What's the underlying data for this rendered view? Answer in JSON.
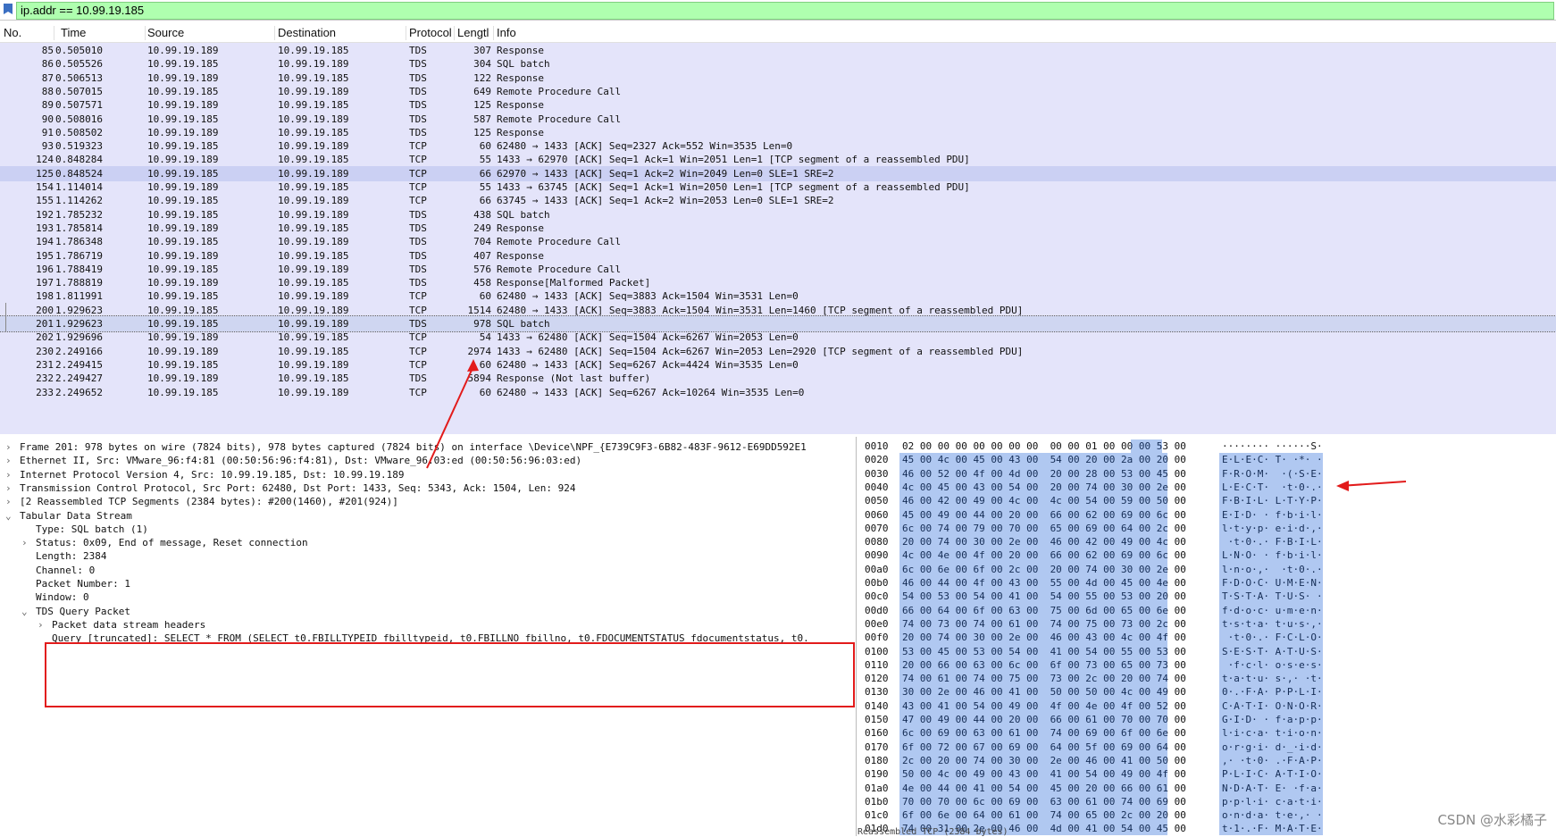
{
  "filter": {
    "text": "ip.addr == 10.99.19.185"
  },
  "columns": [
    "No.",
    "Time",
    "Source",
    "Destination",
    "Protocol",
    "Lengtl",
    "Info"
  ],
  "packets": [
    {
      "no": "85",
      "time": "0.505010",
      "src": "10.99.19.189",
      "dst": "10.99.19.185",
      "proto": "TDS",
      "len": "307",
      "info": "Response"
    },
    {
      "no": "86",
      "time": "0.505526",
      "src": "10.99.19.185",
      "dst": "10.99.19.189",
      "proto": "TDS",
      "len": "304",
      "info": "SQL batch"
    },
    {
      "no": "87",
      "time": "0.506513",
      "src": "10.99.19.189",
      "dst": "10.99.19.185",
      "proto": "TDS",
      "len": "122",
      "info": "Response"
    },
    {
      "no": "88",
      "time": "0.507015",
      "src": "10.99.19.185",
      "dst": "10.99.19.189",
      "proto": "TDS",
      "len": "649",
      "info": "Remote Procedure Call"
    },
    {
      "no": "89",
      "time": "0.507571",
      "src": "10.99.19.189",
      "dst": "10.99.19.185",
      "proto": "TDS",
      "len": "125",
      "info": "Response"
    },
    {
      "no": "90",
      "time": "0.508016",
      "src": "10.99.19.185",
      "dst": "10.99.19.189",
      "proto": "TDS",
      "len": "587",
      "info": "Remote Procedure Call"
    },
    {
      "no": "91",
      "time": "0.508502",
      "src": "10.99.19.189",
      "dst": "10.99.19.185",
      "proto": "TDS",
      "len": "125",
      "info": "Response"
    },
    {
      "no": "93",
      "time": "0.519323",
      "src": "10.99.19.185",
      "dst": "10.99.19.189",
      "proto": "TCP",
      "len": "60",
      "info": "62480 → 1433 [ACK] Seq=2327 Ack=552 Win=3535 Len=0"
    },
    {
      "no": "124",
      "time": "0.848284",
      "src": "10.99.19.189",
      "dst": "10.99.19.185",
      "proto": "TCP",
      "len": "55",
      "info": "1433 → 62970 [ACK] Seq=1 Ack=1 Win=2051 Len=1 [TCP segment of a reassembled PDU]"
    },
    {
      "no": "125",
      "time": "0.848524",
      "src": "10.99.19.185",
      "dst": "10.99.19.189",
      "proto": "TCP",
      "len": "66",
      "info": "62970 → 1433 [ACK] Seq=1 Ack=2 Win=2049 Len=0 SLE=1 SRE=2"
    },
    {
      "no": "154",
      "time": "1.114014",
      "src": "10.99.19.189",
      "dst": "10.99.19.185",
      "proto": "TCP",
      "len": "55",
      "info": "1433 → 63745 [ACK] Seq=1 Ack=1 Win=2050 Len=1 [TCP segment of a reassembled PDU]"
    },
    {
      "no": "155",
      "time": "1.114262",
      "src": "10.99.19.185",
      "dst": "10.99.19.189",
      "proto": "TCP",
      "len": "66",
      "info": "63745 → 1433 [ACK] Seq=1 Ack=2 Win=2053 Len=0 SLE=1 SRE=2"
    },
    {
      "no": "192",
      "time": "1.785232",
      "src": "10.99.19.185",
      "dst": "10.99.19.189",
      "proto": "TDS",
      "len": "438",
      "info": "SQL batch"
    },
    {
      "no": "193",
      "time": "1.785814",
      "src": "10.99.19.189",
      "dst": "10.99.19.185",
      "proto": "TDS",
      "len": "249",
      "info": "Response"
    },
    {
      "no": "194",
      "time": "1.786348",
      "src": "10.99.19.185",
      "dst": "10.99.19.189",
      "proto": "TDS",
      "len": "704",
      "info": "Remote Procedure Call"
    },
    {
      "no": "195",
      "time": "1.786719",
      "src": "10.99.19.189",
      "dst": "10.99.19.185",
      "proto": "TDS",
      "len": "407",
      "info": "Response"
    },
    {
      "no": "196",
      "time": "1.788419",
      "src": "10.99.19.185",
      "dst": "10.99.19.189",
      "proto": "TDS",
      "len": "576",
      "info": "Remote Procedure Call"
    },
    {
      "no": "197",
      "time": "1.788819",
      "src": "10.99.19.189",
      "dst": "10.99.19.185",
      "proto": "TDS",
      "len": "458",
      "info": "Response[Malformed Packet]"
    },
    {
      "no": "198",
      "time": "1.811991",
      "src": "10.99.19.185",
      "dst": "10.99.19.189",
      "proto": "TCP",
      "len": "60",
      "info": "62480 → 1433 [ACK] Seq=3883 Ack=1504 Win=3531 Len=0"
    },
    {
      "no": "200",
      "time": "1.929623",
      "src": "10.99.19.185",
      "dst": "10.99.19.189",
      "proto": "TCP",
      "len": "1514",
      "info": "62480 → 1433 [ACK] Seq=3883 Ack=1504 Win=3531 Len=1460 [TCP segment of a reassembled PDU]"
    },
    {
      "no": "201",
      "time": "1.929623",
      "src": "10.99.19.185",
      "dst": "10.99.19.189",
      "proto": "TDS",
      "len": "978",
      "info": "SQL batch"
    },
    {
      "no": "202",
      "time": "1.929696",
      "src": "10.99.19.189",
      "dst": "10.99.19.185",
      "proto": "TCP",
      "len": "54",
      "info": "1433 → 62480 [ACK] Seq=1504 Ack=6267 Win=2053 Len=0"
    },
    {
      "no": "230",
      "time": "2.249166",
      "src": "10.99.19.189",
      "dst": "10.99.19.185",
      "proto": "TCP",
      "len": "2974",
      "info": "1433 → 62480 [ACK] Seq=1504 Ack=6267 Win=2053 Len=2920 [TCP segment of a reassembled PDU]"
    },
    {
      "no": "231",
      "time": "2.249415",
      "src": "10.99.19.185",
      "dst": "10.99.19.189",
      "proto": "TCP",
      "len": "60",
      "info": "62480 → 1433 [ACK] Seq=6267 Ack=4424 Win=3535 Len=0"
    },
    {
      "no": "232",
      "time": "2.249427",
      "src": "10.99.19.189",
      "dst": "10.99.19.185",
      "proto": "TDS",
      "len": "5894",
      "info": "Response (Not last buffer)"
    },
    {
      "no": "233",
      "time": "2.249652",
      "src": "10.99.19.185",
      "dst": "10.99.19.189",
      "proto": "TCP",
      "len": "60",
      "info": "62480 → 1433 [ACK] Seq=6267 Ack=10264 Win=3535 Len=0"
    }
  ],
  "selected_packet": "201",
  "details": [
    {
      "indent": 0,
      "arrow": "›",
      "text": "Frame 201: 978 bytes on wire (7824 bits), 978 bytes captured (7824 bits) on interface \\Device\\NPF_{E739C9F3-6B82-483F-9612-E69DD592E1"
    },
    {
      "indent": 0,
      "arrow": "›",
      "text": "Ethernet II, Src: VMware_96:f4:81 (00:50:56:96:f4:81), Dst: VMware_96:03:ed (00:50:56:96:03:ed)"
    },
    {
      "indent": 0,
      "arrow": "›",
      "text": "Internet Protocol Version 4, Src: 10.99.19.185, Dst: 10.99.19.189"
    },
    {
      "indent": 0,
      "arrow": "›",
      "text": "Transmission Control Protocol, Src Port: 62480, Dst Port: 1433, Seq: 5343, Ack: 1504, Len: 924"
    },
    {
      "indent": 0,
      "arrow": "›",
      "text": "[2 Reassembled TCP Segments (2384 bytes): #200(1460), #201(924)]"
    },
    {
      "indent": 0,
      "arrow": "⌄",
      "text": "Tabular Data Stream"
    },
    {
      "indent": 1,
      "arrow": "",
      "text": "Type: SQL batch (1)"
    },
    {
      "indent": 1,
      "arrow": "›",
      "text": "Status: 0x09, End of message, Reset connection"
    },
    {
      "indent": 1,
      "arrow": "",
      "text": "Length: 2384"
    },
    {
      "indent": 1,
      "arrow": "",
      "text": "Channel: 0"
    },
    {
      "indent": 1,
      "arrow": "",
      "text": "Packet Number: 1"
    },
    {
      "indent": 1,
      "arrow": "",
      "text": "Window: 0"
    },
    {
      "indent": 1,
      "arrow": "⌄",
      "text": "TDS Query Packet"
    },
    {
      "indent": 2,
      "arrow": "›",
      "text": "Packet data stream headers"
    },
    {
      "indent": 2,
      "arrow": "",
      "text": "Query [truncated]: SELECT * FROM (SELECT t0.FBILLTYPEID fbilltypeid, t0.FBILLNO fbillno, t0.FDOCUMENTSTATUS fdocumentstatus, t0."
    }
  ],
  "hex": [
    {
      "off": "0010",
      "bytes": "02 00 00 00 00 00 00 00  00 00 01 00 00 00 53 00",
      "ascii": "········ ······S·"
    },
    {
      "off": "0020",
      "bytes": "45 00 4c 00 45 00 43 00  54 00 20 00 2a 00 20 00",
      "ascii": "E·L·E·C· T· ·*· ·"
    },
    {
      "off": "0030",
      "bytes": "46 00 52 00 4f 00 4d 00  20 00 28 00 53 00 45 00",
      "ascii": "F·R·O·M·  ·(·S·E·"
    },
    {
      "off": "0040",
      "bytes": "4c 00 45 00 43 00 54 00  20 00 74 00 30 00 2e 00",
      "ascii": "L·E·C·T·  ·t·0·.·"
    },
    {
      "off": "0050",
      "bytes": "46 00 42 00 49 00 4c 00  4c 00 54 00 59 00 50 00",
      "ascii": "F·B·I·L· L·T·Y·P·"
    },
    {
      "off": "0060",
      "bytes": "45 00 49 00 44 00 20 00  66 00 62 00 69 00 6c 00",
      "ascii": "E·I·D· · f·b·i·l·"
    },
    {
      "off": "0070",
      "bytes": "6c 00 74 00 79 00 70 00  65 00 69 00 64 00 2c 00",
      "ascii": "l·t·y·p· e·i·d·,·"
    },
    {
      "off": "0080",
      "bytes": "20 00 74 00 30 00 2e 00  46 00 42 00 49 00 4c 00",
      "ascii": " ·t·0·.· F·B·I·L·"
    },
    {
      "off": "0090",
      "bytes": "4c 00 4e 00 4f 00 20 00  66 00 62 00 69 00 6c 00",
      "ascii": "L·N·O· · f·b·i·l·"
    },
    {
      "off": "00a0",
      "bytes": "6c 00 6e 00 6f 00 2c 00  20 00 74 00 30 00 2e 00",
      "ascii": "l·n·o·,·  ·t·0·.·"
    },
    {
      "off": "00b0",
      "bytes": "46 00 44 00 4f 00 43 00  55 00 4d 00 45 00 4e 00",
      "ascii": "F·D·O·C· U·M·E·N·"
    },
    {
      "off": "00c0",
      "bytes": "54 00 53 00 54 00 41 00  54 00 55 00 53 00 20 00",
      "ascii": "T·S·T·A· T·U·S· ·"
    },
    {
      "off": "00d0",
      "bytes": "66 00 64 00 6f 00 63 00  75 00 6d 00 65 00 6e 00",
      "ascii": "f·d·o·c· u·m·e·n·"
    },
    {
      "off": "00e0",
      "bytes": "74 00 73 00 74 00 61 00  74 00 75 00 73 00 2c 00",
      "ascii": "t·s·t·a· t·u·s·,·"
    },
    {
      "off": "00f0",
      "bytes": "20 00 74 00 30 00 2e 00  46 00 43 00 4c 00 4f 00",
      "ascii": " ·t·0·.· F·C·L·O·"
    },
    {
      "off": "0100",
      "bytes": "53 00 45 00 53 00 54 00  41 00 54 00 55 00 53 00",
      "ascii": "S·E·S·T· A·T·U·S·"
    },
    {
      "off": "0110",
      "bytes": "20 00 66 00 63 00 6c 00  6f 00 73 00 65 00 73 00",
      "ascii": " ·f·c·l· o·s·e·s·"
    },
    {
      "off": "0120",
      "bytes": "74 00 61 00 74 00 75 00  73 00 2c 00 20 00 74 00",
      "ascii": "t·a·t·u· s·,· ·t·"
    },
    {
      "off": "0130",
      "bytes": "30 00 2e 00 46 00 41 00  50 00 50 00 4c 00 49 00",
      "ascii": "0·.·F·A· P·P·L·I·"
    },
    {
      "off": "0140",
      "bytes": "43 00 41 00 54 00 49 00  4f 00 4e 00 4f 00 52 00",
      "ascii": "C·A·T·I· O·N·O·R·"
    },
    {
      "off": "0150",
      "bytes": "47 00 49 00 44 00 20 00  66 00 61 00 70 00 70 00",
      "ascii": "G·I·D· · f·a·p·p·"
    },
    {
      "off": "0160",
      "bytes": "6c 00 69 00 63 00 61 00  74 00 69 00 6f 00 6e 00",
      "ascii": "l·i·c·a· t·i·o·n·"
    },
    {
      "off": "0170",
      "bytes": "6f 00 72 00 67 00 69 00  64 00 5f 00 69 00 64 00",
      "ascii": "o·r·g·i· d·_·i·d·"
    },
    {
      "off": "0180",
      "bytes": "2c 00 20 00 74 00 30 00  2e 00 46 00 41 00 50 00",
      "ascii": ",· ·t·0· .·F·A·P·"
    },
    {
      "off": "0190",
      "bytes": "50 00 4c 00 49 00 43 00  41 00 54 00 49 00 4f 00",
      "ascii": "P·L·I·C· A·T·I·O·"
    },
    {
      "off": "01a0",
      "bytes": "4e 00 44 00 41 00 54 00  45 00 20 00 66 00 61 00",
      "ascii": "N·D·A·T· E· ·f·a·"
    },
    {
      "off": "01b0",
      "bytes": "70 00 70 00 6c 00 69 00  63 00 61 00 74 00 69 00",
      "ascii": "p·p·l·i· c·a·t·i·"
    },
    {
      "off": "01c0",
      "bytes": "6f 00 6e 00 64 00 61 00  74 00 65 00 2c 00 20 00",
      "ascii": "o·n·d·a· t·e·,· ·"
    },
    {
      "off": "01d0",
      "bytes": "74 00 31 00 2e 00 46 00  4d 00 41 00 54 00 45 00",
      "ascii": "t·1·.·F· M·A·T·E·"
    }
  ],
  "status_text": "Reassembled TCP (2384 bytes)",
  "watermark": "CSDN @水彩橘子"
}
